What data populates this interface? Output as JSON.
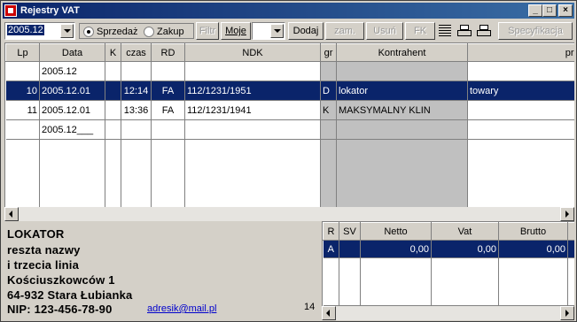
{
  "window": {
    "title": "Rejestry VAT",
    "btn_min": "_",
    "btn_max": "□",
    "btn_close": "×"
  },
  "toolbar": {
    "date_value": "2005.12",
    "radio_sprzedaz": "Sprzedaż",
    "radio_zakup": "Zakup",
    "selected_radio": "Sprzedaż",
    "filtr": "Filtr",
    "moje": "Moje",
    "moje_value": "",
    "dodaj": "Dodaj",
    "zam": "zam.",
    "usun": "Usuń",
    "fk": "FK",
    "specyfikacja": "Specyfikacja"
  },
  "grid": {
    "columns": [
      "Lp",
      "Data",
      "K",
      "czas",
      "RD",
      "NDK",
      "gr",
      "Kontrahent",
      "przedmiot"
    ],
    "rows": [
      {
        "lp": "",
        "data": "2005.12",
        "k": "",
        "czas": "",
        "rd": "",
        "ndk": "",
        "gr": "",
        "kontrahent": "",
        "przedmiot": ""
      },
      {
        "lp": "10",
        "data": "2005.12.01",
        "k": "",
        "czas": "12:14",
        "rd": "FA",
        "ndk": "112/1231/1951",
        "gr": "D",
        "kontrahent": "lokator",
        "przedmiot": "towary"
      },
      {
        "lp": "11",
        "data": "2005.12.01",
        "k": "",
        "czas": "13:36",
        "rd": "FA",
        "ndk": "112/1231/1941",
        "gr": "K",
        "kontrahent": "MAKSYMALNY KLIN",
        "przedmiot": ""
      },
      {
        "lp": "",
        "data": "2005.12___",
        "k": "",
        "czas": "",
        "rd": "",
        "ndk": "",
        "gr": "",
        "kontrahent": "",
        "przedmiot": ""
      }
    ]
  },
  "contractor": {
    "name": "LOKATOR",
    "line2": "reszta nazwy",
    "line3": "i trzecia linia",
    "street": "Kościuszkowców 1",
    "city": "64-932 Stara Łubianka",
    "nip": "NIP: 123-456-78-90",
    "email": "adresik@mail.pl",
    "count": "14"
  },
  "vat_table": {
    "columns": [
      "R",
      "SV",
      "Netto",
      "Vat",
      "Brutto"
    ],
    "rows": [
      {
        "r": "A",
        "sv": "",
        "netto": "0,00",
        "vat": "0,00",
        "brutto": "0,00"
      }
    ]
  }
}
